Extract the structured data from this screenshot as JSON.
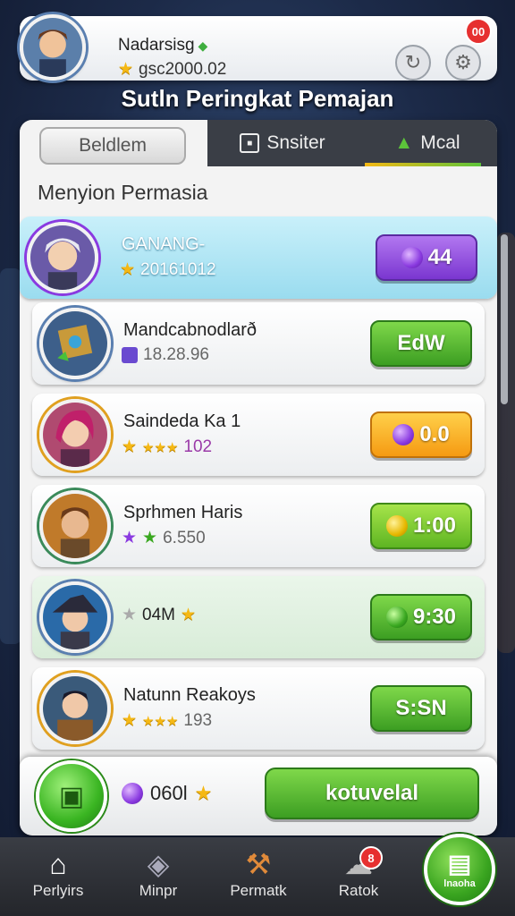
{
  "player": {
    "name": "Nadarsisg",
    "score": "gsc2000.02",
    "notification_count": "00"
  },
  "screen_title": "Sutln Peringkat Pemajan",
  "tabs": [
    {
      "label": "Beldlem"
    },
    {
      "label": "Snsiter"
    },
    {
      "label": "Mcal"
    }
  ],
  "section_title": "Menyion Permasia",
  "leaderboard": [
    {
      "name": "GANANG-",
      "score": "20161012",
      "button": "44",
      "button_color": "#8a3ae0"
    },
    {
      "name": "Mandcabnodlarð",
      "score": "18.28.96",
      "button": "EdW",
      "button_color": "#3c9e22"
    },
    {
      "name": "Saindeda Ka 1",
      "score": "102",
      "button": "0.0",
      "button_color": "#f59a12"
    },
    {
      "name": "Sprhmen Haris",
      "score": "6.550",
      "button": "1:00",
      "button_color": "#5eb522"
    },
    {
      "name": "",
      "score": "04M",
      "button": "9:30",
      "button_color": "#3c9e22"
    },
    {
      "name": "Natunn Reakoys",
      "score": "193",
      "button": "S:SN",
      "button_color": "#3c9e22"
    }
  ],
  "footer": {
    "value": "060l",
    "button": "kotuvelal"
  },
  "nav": [
    {
      "label": "Perlyirs",
      "icon": "home-icon"
    },
    {
      "label": "Minpr",
      "icon": "map-icon"
    },
    {
      "label": "Permatk",
      "icon": "hammer-icon"
    },
    {
      "label": "Ratok",
      "icon": "chat-icon",
      "badge": "8"
    },
    {
      "label": "lnaoha",
      "icon": "card-icon"
    }
  ]
}
